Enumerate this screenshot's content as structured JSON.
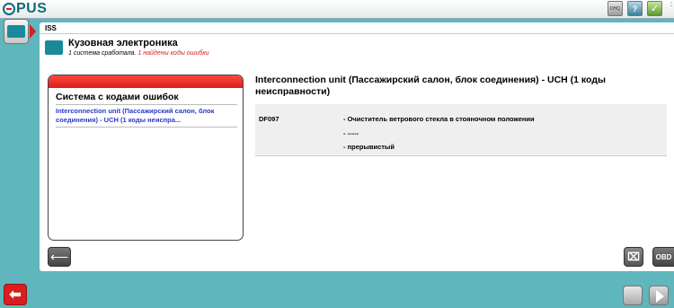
{
  "app": {
    "logo_text": "PUS"
  },
  "tab": {
    "label": "ISS"
  },
  "header": {
    "title": "Кузовная электроника",
    "summary": "1 система сработала.",
    "error_summary": "1 найдены коды ошибки"
  },
  "panel": {
    "title": "Система с кодами ошибок",
    "items": [
      "Interconnection unit (Пассажирский салон, блок соединения) - UCH (1 коды неиспра..."
    ]
  },
  "detail": {
    "title": "Interconnection unit (Пассажирский салон, блок соединения) - UCH (1 коды неисправности)",
    "code": "DF097",
    "lines": [
      "- Очиститель ветрового стекла в стояночном положении",
      "- -----",
      "- прерывистый"
    ]
  },
  "buttons": {
    "obd": "OBD"
  },
  "topbar": {
    "dhq": "DHQ",
    "help": "?",
    "check": "✓"
  },
  "icons": {
    "nav": "ecu-icon",
    "back": "back-arrow-icon",
    "clear": "clear-codes-icon",
    "print": "print-icon",
    "next": "next-arrow-icon"
  },
  "colors": {
    "accent": "#5fb6bc",
    "alert": "#d81e1e",
    "link": "#2a39c8"
  }
}
